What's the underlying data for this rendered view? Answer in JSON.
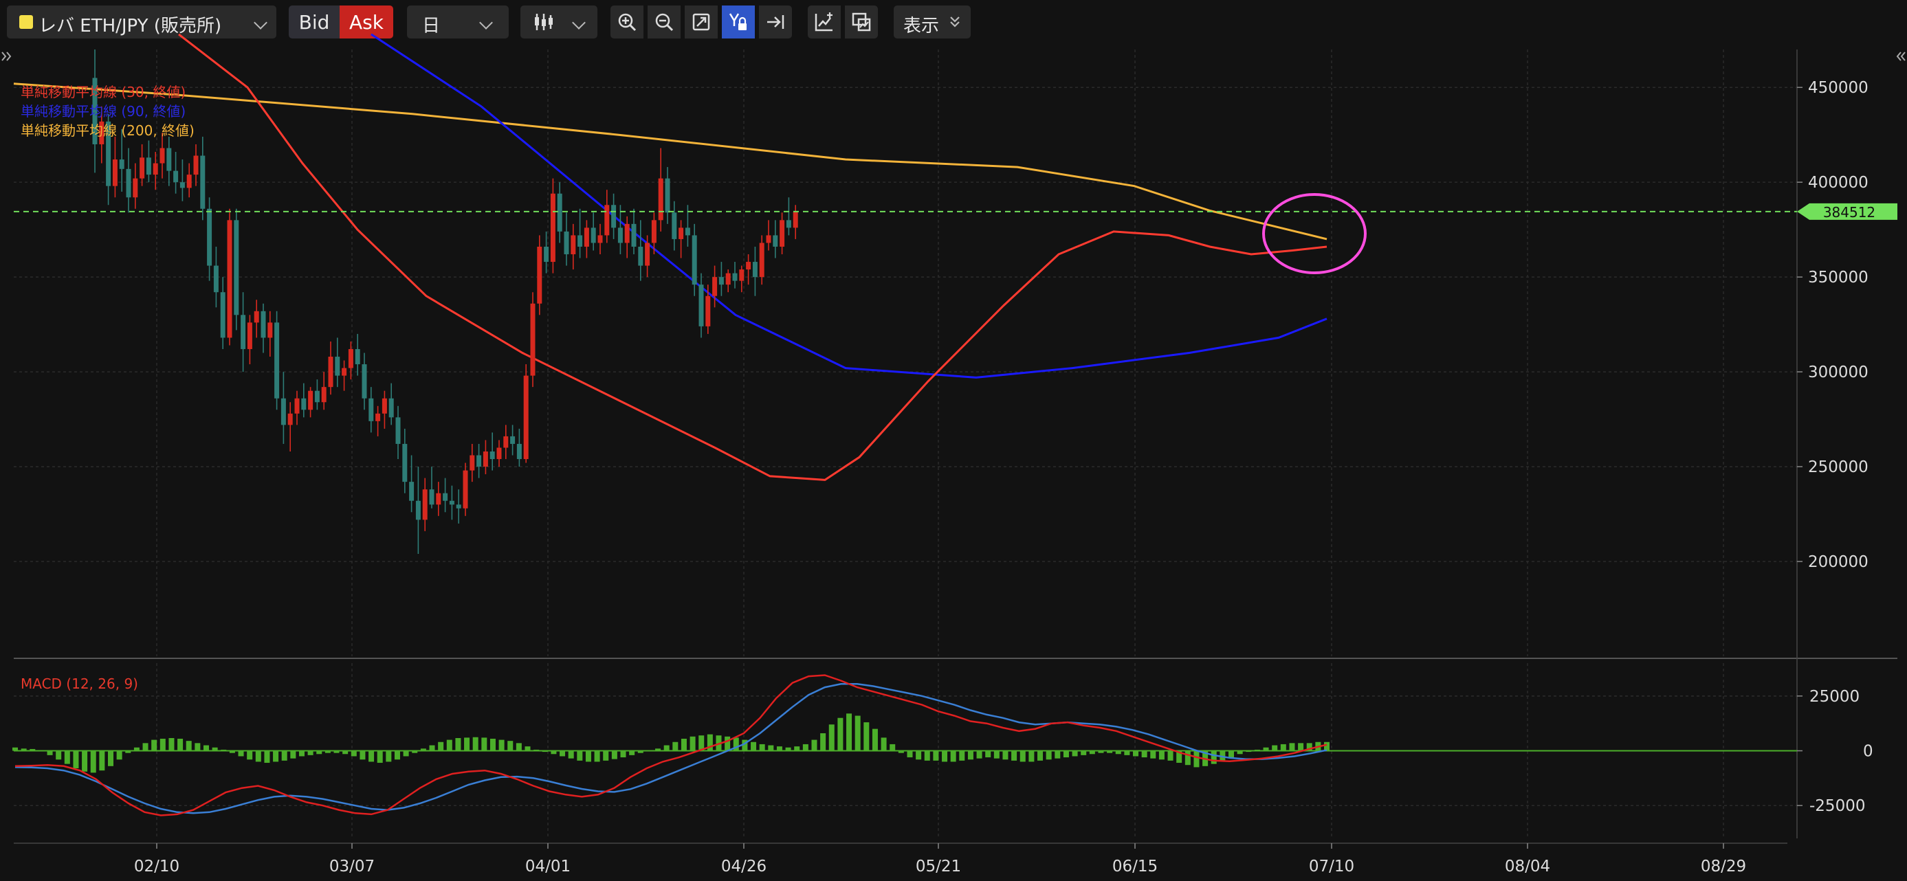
{
  "toolbar": {
    "symbol": "レバ ETH/JPY (販売所)",
    "symbol_color": "#f5e04a",
    "bid_label": "Bid",
    "ask_label": "Ask",
    "ask_color": "#c8241f",
    "timeframe": "日",
    "display_label": "表示",
    "icons": [
      "chart-type-candlestick-icon",
      "zoom-in-icon",
      "zoom-out-icon",
      "fit-screen-icon",
      "auto-scale-lock-icon",
      "scroll-to-latest-icon",
      "add-indicator-icon",
      "compare-icon"
    ]
  },
  "legend": {
    "sma30": "単純移動平均線 (30, 終値)",
    "sma90": "単純移動平均線 (90, 終値)",
    "sma200": "単純移動平均線 (200, 終値)"
  },
  "colors": {
    "sma30": "#ff3b30",
    "sma90": "#1a1aff",
    "sma200": "#f4b43a",
    "up": "#d8291f",
    "down": "#2e7d77",
    "current_price": "#72e05b",
    "highlight": "#ff4ddf",
    "macd_hist": "#4caf2a",
    "macd_line": "#e02020",
    "signal_line": "#3a7fd5"
  },
  "macd_title": "MACD (12, 26, 9)",
  "price_axis": {
    "labels": [
      "450000",
      "400000",
      "350000",
      "300000",
      "250000",
      "200000"
    ]
  },
  "current_price": {
    "value": 384512,
    "label": "384512"
  },
  "macd_axis": {
    "labels": [
      "25000",
      "0",
      "-25000"
    ]
  },
  "date_labels": [
    "02/10",
    "03/07",
    "04/01",
    "04/26",
    "05/21",
    "06/15",
    "07/10",
    "08/04",
    "08/29"
  ],
  "chart_data": {
    "type": "candlestick",
    "x_start_date": "2021-01-16",
    "price_range": [
      150000,
      470000
    ],
    "macd_range": [
      -40000,
      40000
    ],
    "candles": [
      [
        455000,
        470000,
        405000,
        420000
      ],
      [
        420000,
        440000,
        410000,
        432000
      ],
      [
        432000,
        436000,
        388000,
        398000
      ],
      [
        398000,
        424000,
        392000,
        412000
      ],
      [
        412000,
        428000,
        395000,
        407000
      ],
      [
        407000,
        418000,
        384000,
        392000
      ],
      [
        392000,
        410000,
        386000,
        402000
      ],
      [
        402000,
        420000,
        398000,
        413000
      ],
      [
        413000,
        422000,
        400000,
        404000
      ],
      [
        404000,
        416000,
        396000,
        410000
      ],
      [
        410000,
        426000,
        402000,
        418000
      ],
      [
        418000,
        424000,
        398000,
        406000
      ],
      [
        406000,
        416000,
        394000,
        400000
      ],
      [
        400000,
        412000,
        390000,
        397000
      ],
      [
        397000,
        410000,
        392000,
        404000
      ],
      [
        404000,
        420000,
        398000,
        414000
      ],
      [
        414000,
        424000,
        380000,
        386000
      ],
      [
        386000,
        392000,
        348000,
        356000
      ],
      [
        356000,
        366000,
        334000,
        342000
      ],
      [
        342000,
        350000,
        312000,
        318000
      ],
      [
        318000,
        386000,
        314000,
        380000
      ],
      [
        380000,
        386000,
        322000,
        330000
      ],
      [
        330000,
        342000,
        300000,
        312000
      ],
      [
        312000,
        330000,
        304000,
        326000
      ],
      [
        326000,
        338000,
        318000,
        332000
      ],
      [
        332000,
        336000,
        310000,
        318000
      ],
      [
        318000,
        332000,
        308000,
        326000
      ],
      [
        326000,
        332000,
        280000,
        286000
      ],
      [
        286000,
        300000,
        262000,
        272000
      ],
      [
        272000,
        284000,
        258000,
        278000
      ],
      [
        278000,
        290000,
        272000,
        286000
      ],
      [
        286000,
        294000,
        276000,
        280000
      ],
      [
        280000,
        292000,
        276000,
        290000
      ],
      [
        290000,
        296000,
        280000,
        284000
      ],
      [
        284000,
        300000,
        280000,
        292000
      ],
      [
        292000,
        316000,
        288000,
        308000
      ],
      [
        308000,
        318000,
        292000,
        298000
      ],
      [
        298000,
        306000,
        290000,
        302000
      ],
      [
        302000,
        316000,
        296000,
        312000
      ],
      [
        312000,
        320000,
        298000,
        304000
      ],
      [
        304000,
        310000,
        280000,
        286000
      ],
      [
        286000,
        292000,
        268000,
        274000
      ],
      [
        274000,
        282000,
        266000,
        278000
      ],
      [
        278000,
        290000,
        270000,
        286000
      ],
      [
        286000,
        294000,
        272000,
        276000
      ],
      [
        276000,
        282000,
        254000,
        262000
      ],
      [
        262000,
        270000,
        236000,
        242000
      ],
      [
        242000,
        256000,
        226000,
        232000
      ],
      [
        232000,
        250000,
        204000,
        222000
      ],
      [
        222000,
        244000,
        216000,
        238000
      ],
      [
        238000,
        250000,
        228000,
        230000
      ],
      [
        230000,
        242000,
        224000,
        236000
      ],
      [
        236000,
        244000,
        226000,
        232000
      ],
      [
        232000,
        240000,
        222000,
        230000
      ],
      [
        230000,
        238000,
        220000,
        228000
      ],
      [
        228000,
        252000,
        224000,
        248000
      ],
      [
        248000,
        262000,
        242000,
        256000
      ],
      [
        256000,
        262000,
        244000,
        250000
      ],
      [
        250000,
        264000,
        246000,
        258000
      ],
      [
        258000,
        268000,
        248000,
        254000
      ],
      [
        254000,
        264000,
        250000,
        260000
      ],
      [
        260000,
        272000,
        254000,
        266000
      ],
      [
        266000,
        272000,
        256000,
        262000
      ],
      [
        262000,
        270000,
        250000,
        254000
      ],
      [
        254000,
        304000,
        252000,
        298000
      ],
      [
        298000,
        342000,
        292000,
        336000
      ],
      [
        336000,
        372000,
        330000,
        366000
      ],
      [
        366000,
        374000,
        352000,
        358000
      ],
      [
        358000,
        402000,
        352000,
        394000
      ],
      [
        394000,
        400000,
        368000,
        374000
      ],
      [
        374000,
        384000,
        356000,
        362000
      ],
      [
        362000,
        378000,
        354000,
        372000
      ],
      [
        372000,
        386000,
        360000,
        366000
      ],
      [
        366000,
        380000,
        360000,
        376000
      ],
      [
        376000,
        384000,
        364000,
        368000
      ],
      [
        368000,
        378000,
        362000,
        372000
      ],
      [
        372000,
        396000,
        368000,
        388000
      ],
      [
        388000,
        394000,
        370000,
        376000
      ],
      [
        376000,
        388000,
        362000,
        368000
      ],
      [
        368000,
        382000,
        360000,
        378000
      ],
      [
        378000,
        386000,
        362000,
        366000
      ],
      [
        366000,
        380000,
        348000,
        356000
      ],
      [
        356000,
        372000,
        350000,
        368000
      ],
      [
        368000,
        384000,
        362000,
        380000
      ],
      [
        380000,
        418000,
        374000,
        402000
      ],
      [
        402000,
        408000,
        378000,
        384000
      ],
      [
        384000,
        390000,
        364000,
        370000
      ],
      [
        370000,
        380000,
        360000,
        376000
      ],
      [
        376000,
        388000,
        366000,
        372000
      ],
      [
        372000,
        378000,
        340000,
        346000
      ],
      [
        346000,
        352000,
        318000,
        324000
      ],
      [
        324000,
        346000,
        320000,
        340000
      ],
      [
        340000,
        356000,
        334000,
        350000
      ],
      [
        350000,
        358000,
        340000,
        346000
      ],
      [
        346000,
        354000,
        342000,
        352000
      ],
      [
        352000,
        358000,
        344000,
        348000
      ],
      [
        348000,
        356000,
        342000,
        354000
      ],
      [
        354000,
        362000,
        346000,
        358000
      ],
      [
        358000,
        366000,
        340000,
        350000
      ],
      [
        350000,
        372000,
        346000,
        368000
      ],
      [
        368000,
        380000,
        364000,
        372000
      ],
      [
        372000,
        380000,
        360000,
        366000
      ],
      [
        366000,
        384000,
        362000,
        380000
      ],
      [
        380000,
        392000,
        372000,
        376000
      ],
      [
        376000,
        388000,
        370000,
        384512
      ]
    ],
    "macd_hist": [
      1500,
      1000,
      800,
      0,
      -2000,
      -4000,
      -6000,
      -8000,
      -9500,
      -10000,
      -9000,
      -7000,
      -4000,
      -1000,
      1500,
      3500,
      5000,
      5500,
      5800,
      5500,
      4500,
      3500,
      2500,
      1500,
      500,
      -1000,
      -2500,
      -4000,
      -5000,
      -5500,
      -5000,
      -4500,
      -3500,
      -2500,
      -2000,
      -1500,
      -1000,
      -1000,
      -1500,
      -2500,
      -4000,
      -5000,
      -5500,
      -5000,
      -4000,
      -2500,
      -1000,
      1000,
      2500,
      4000,
      5000,
      5800,
      6000,
      6200,
      6000,
      5500,
      5000,
      4500,
      3500,
      2000,
      500,
      -500,
      -1500,
      -2500,
      -3500,
      -4500,
      -5000,
      -5000,
      -4500,
      -3800,
      -3000,
      -2000,
      -1000,
      0,
      1000,
      2500,
      4000,
      5500,
      6500,
      7000,
      7500,
      7000,
      6500,
      6000,
      5000,
      4000,
      3000,
      2500,
      2000,
      1500,
      2000,
      3000,
      5000,
      8000,
      12000,
      15000,
      17000,
      16000,
      13000,
      10000,
      6000,
      3000,
      -1000,
      -3000,
      -4000,
      -4500,
      -4500,
      -5000,
      -5000,
      -4500,
      -4000,
      -3500,
      -3000,
      -3500,
      -4000,
      -4500,
      -5000,
      -5000,
      -4500,
      -4000,
      -3500,
      -3000,
      -2500,
      -2000,
      -1500,
      -1000,
      -1000,
      -1500,
      -2000,
      -2500,
      -3000,
      -3500,
      -4000,
      -4500,
      -5500,
      -6500,
      -7500,
      -7000,
      -6000,
      -4500,
      -3000,
      -1500,
      -500,
      500,
      1500,
      2500,
      3000,
      3500,
      3500,
      3500,
      4000,
      4000
    ],
    "macd_line": [
      -7000,
      -6800,
      -6500,
      -7000,
      -9000,
      -13000,
      -19000,
      -24000,
      -28000,
      -29500,
      -29000,
      -27000,
      -23000,
      -19000,
      -17000,
      -16000,
      -18000,
      -21000,
      -23500,
      -25000,
      -27000,
      -28500,
      -29000,
      -27000,
      -22000,
      -17000,
      -13000,
      -10500,
      -9500,
      -9000,
      -10500,
      -13000,
      -16000,
      -18500,
      -20000,
      -21000,
      -20000,
      -17000,
      -12000,
      -8000,
      -5000,
      -3000,
      -500,
      2000,
      4500,
      8000,
      15000,
      24000,
      31000,
      34000,
      34500,
      32000,
      29000,
      27000,
      25000,
      23000,
      21000,
      18000,
      16000,
      13500,
      12500,
      10500,
      9000,
      10000,
      12500,
      13000,
      11500,
      10500,
      9000,
      6500,
      4000,
      1500,
      -1000,
      -3000,
      -4500,
      -4800,
      -4200,
      -3500,
      -2500,
      -1000,
      1000,
      2800
    ],
    "signal_line": [
      -7500,
      -7600,
      -8000,
      -9000,
      -11000,
      -14000,
      -17500,
      -21000,
      -24000,
      -26500,
      -28000,
      -28500,
      -28000,
      -26500,
      -24500,
      -22500,
      -21000,
      -20500,
      -21000,
      -22000,
      -23500,
      -25000,
      -26500,
      -27000,
      -26000,
      -24000,
      -21500,
      -18500,
      -15500,
      -13500,
      -12000,
      -11800,
      -12500,
      -14000,
      -15800,
      -17400,
      -18500,
      -18800,
      -17500,
      -15000,
      -12000,
      -9000,
      -6000,
      -3000,
      0,
      3000,
      8000,
      14000,
      20000,
      25500,
      29000,
      30500,
      30500,
      29500,
      28000,
      26500,
      25000,
      23000,
      21000,
      18500,
      16500,
      15000,
      13000,
      12000,
      12500,
      13000,
      12500,
      12000,
      11000,
      9500,
      7500,
      5000,
      2500,
      0,
      -2000,
      -3200,
      -3800,
      -3800,
      -3300,
      -2500,
      -1200,
      300
    ]
  }
}
